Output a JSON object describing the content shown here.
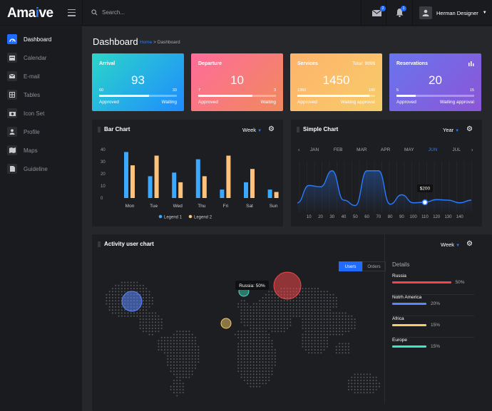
{
  "app": {
    "logo_prefix": "Ama",
    "logo_dot": "i",
    "logo_suffix": "ve"
  },
  "search": {
    "placeholder": "Search..."
  },
  "header": {
    "mail_badge": "2",
    "bell_badge": "1",
    "user_name": "Herman Designer"
  },
  "sidebar": {
    "items": [
      {
        "label": "Dashboard",
        "icon": "speedometer-icon",
        "active": true
      },
      {
        "label": "Calendar",
        "icon": "calendar-icon"
      },
      {
        "label": "E-mail",
        "icon": "mail-icon"
      },
      {
        "label": "Tables",
        "icon": "table-icon"
      },
      {
        "label": "Icon Set",
        "icon": "camera-icon"
      },
      {
        "label": "Profile",
        "icon": "user-icon"
      },
      {
        "label": "Maps",
        "icon": "map-icon"
      },
      {
        "label": "Guideline",
        "icon": "document-icon"
      }
    ]
  },
  "page": {
    "title": "Dashboard",
    "crumb_home": "Home",
    "crumb_sep": " > ",
    "crumb_current": "Dashboard"
  },
  "cards": [
    {
      "title": "Arrival",
      "value": "93",
      "left_num": "60",
      "right_num": "33",
      "progress": 0.64,
      "left_label": "Approved",
      "right_label": "Waiting",
      "color_from": "#2bd6c9",
      "color_to": "#1f8bff"
    },
    {
      "title": "Departure",
      "value": "10",
      "left_num": "7",
      "right_num": "3",
      "progress": 0.7,
      "left_label": "Approved",
      "right_label": "Waiting",
      "color_from": "#ff6b9a",
      "color_to": "#f08a5d"
    },
    {
      "title": "Services",
      "top_right": "Total: 999$",
      "value": "1450",
      "left_num": "1350",
      "right_num": "100",
      "progress": 0.93,
      "left_label": "Approved",
      "right_label": "Waiting approval",
      "color_from": "#ffb36b",
      "color_to": "#f6cc6a"
    },
    {
      "title": "Reservations",
      "value": "20",
      "left_num": "5",
      "right_num": "15",
      "progress": 0.25,
      "left_label": "Approved",
      "right_label": "Waiting approval",
      "color_from": "#6a74ee",
      "color_to": "#8b56d6",
      "top_icon": "bar-chart-icon"
    }
  ],
  "bar_panel": {
    "title": "Bar Chart",
    "dropdown": "Week"
  },
  "line_panel": {
    "title": "Simple Chart",
    "dropdown": "Year",
    "months": [
      "JAN",
      "FEB",
      "MAR",
      "APR",
      "MAY",
      "JUN",
      "JUL"
    ],
    "active_month": "JUN",
    "tooltip": "$200"
  },
  "activity": {
    "title": "Activity user chart",
    "dropdown": "Week",
    "tab_users": "Users",
    "tab_orders": "Orders",
    "map_tooltip": "Russia: 50%",
    "details_title": "Details",
    "details": [
      {
        "name": "Russia",
        "pct": "50%",
        "fraction": 0.5,
        "color": "#f0474c"
      },
      {
        "name": "Notrh America",
        "pct": "20%",
        "fraction": 0.2,
        "color": "#5a86ff"
      },
      {
        "name": "Africa",
        "pct": "15%",
        "fraction": 0.15,
        "color": "#f6cc6a"
      },
      {
        "name": "Europe",
        "pct": "15%",
        "fraction": 0.15,
        "color": "#3de8c8"
      }
    ]
  },
  "chart_data": [
    {
      "type": "bar",
      "categories": [
        "Mon",
        "Tue",
        "Wed",
        "Thu",
        "Fri",
        "Sat",
        "Sun"
      ],
      "series": [
        {
          "name": "Legend 1",
          "values": [
            38,
            18,
            21,
            32,
            7,
            13,
            7
          ],
          "color": "#3aa9ff"
        },
        {
          "name": "Legend 2",
          "values": [
            27,
            35,
            13,
            18,
            35,
            24,
            5
          ],
          "color": "#ffc27a"
        }
      ],
      "yticks": [
        0,
        10,
        20,
        30,
        40
      ],
      "ylim": [
        0,
        40
      ],
      "legend": "bottom"
    },
    {
      "type": "line",
      "x": [
        0,
        10,
        20,
        30,
        40,
        50,
        60,
        70,
        80,
        90,
        100,
        110,
        120,
        130,
        140,
        150
      ],
      "y": [
        30,
        95,
        90,
        150,
        40,
        20,
        150,
        150,
        25,
        60,
        30,
        32,
        42,
        40,
        30,
        40
      ],
      "xticks": [
        10,
        20,
        30,
        40,
        50,
        60,
        70,
        80,
        90,
        100,
        110,
        120,
        130,
        140
      ],
      "highlight_x": 110,
      "color": "#2a7bff"
    }
  ],
  "map_bubbles": [
    {
      "label": "North America",
      "color": "#5a86ff"
    },
    {
      "label": "Russia",
      "color": "#f0474c"
    },
    {
      "label": "Europe",
      "color": "#3de8c8"
    },
    {
      "label": "Africa",
      "color": "#f6cc6a"
    }
  ]
}
